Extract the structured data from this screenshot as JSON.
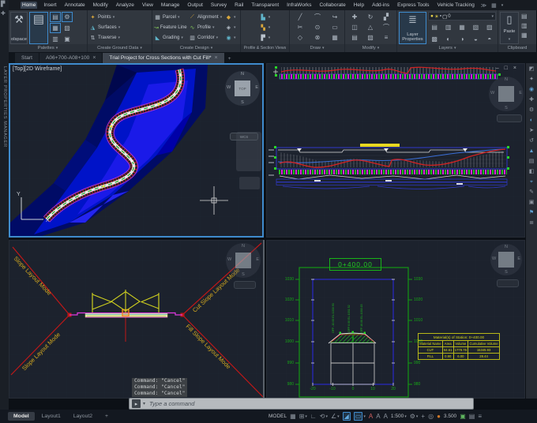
{
  "menubar": {
    "tabs": [
      "Home",
      "Insert",
      "Annotate",
      "Modify",
      "Analyze",
      "View",
      "Manage",
      "Output",
      "Survey",
      "Rail",
      "Transparent",
      "InfraWorks",
      "Collaborate",
      "Help",
      "Add-ins",
      "Express Tools",
      "Vehicle Tracking"
    ],
    "active_tab": "Home"
  },
  "glyphs": {
    "caret": "▾",
    "close": "×",
    "plus": "+",
    "minimize": "–",
    "restore": "□",
    "tools": "⚒",
    "toolspace_big": "▤",
    "points": "✦",
    "surfaces": "◮",
    "traverse": "⇅",
    "parcel": "▦",
    "feature_line": "↝",
    "grading": "◣",
    "alignment": "⟋",
    "profile": "∿",
    "corridor": "▥",
    "design_x1": "◆",
    "design_x2": "◈",
    "design_x3": "◉",
    "psv1": "▙",
    "psv2": "▚",
    "psv3": "▛",
    "d1": "╱",
    "d2": "⌒",
    "d3": "↪",
    "d4": "✂",
    "d5": "⊙",
    "d6": "▭",
    "d7": "◇",
    "d8": "⊗",
    "d9": "▦",
    "m1": "✚",
    "m2": "↻",
    "m3": "▞",
    "m4": "◫",
    "m5": "△",
    "m6": "⌒",
    "m7": "▤",
    "m8": "▧",
    "m9": "≡",
    "p1": "▤",
    "p2": "⚙",
    "p3": "▦",
    "p4": "▧",
    "p5": "▥",
    "p6": "▣",
    "bulb": "●",
    "sun": "☀",
    "lock": "▪",
    "swatch": "▢",
    "l1": "▤",
    "l2": "▥",
    "l3": "▦",
    "l4": "▧",
    "l5": "▨",
    "l6": "▩",
    "l7": "◐",
    "l8": "◑",
    "l9": "◒",
    "l10": "◓",
    "paste": "▯",
    "c1": "▤",
    "c2": "▥",
    "c3": "▦",
    "layer_props": "≣",
    "cmd": "▸",
    "app1": "▛",
    "app2": "✚",
    "ic1": "≫",
    "ic2": "▦",
    "ucs_x": "X",
    "ucs_y": "Y"
  },
  "ribbon": {
    "palettes": {
      "label": "Palettes",
      "toolspace_label": "olspace"
    },
    "create_ground_data": {
      "label": "Create Ground Data",
      "items": [
        "Points",
        "Surfaces",
        "Traverse"
      ]
    },
    "create_design": {
      "label": "Create Design",
      "col1": [
        "Parcel",
        "Feature Line",
        "Grading"
      ],
      "col2": [
        "Alignment",
        "Profile",
        "Corridor"
      ]
    },
    "profile_section_views": {
      "label": "Profile & Section Views"
    },
    "draw": {
      "label": "Draw"
    },
    "modify": {
      "label": "Modify"
    },
    "layers": {
      "label": "Layers",
      "button_label": "Layer Properties",
      "current_layer": "0"
    },
    "clipboard": {
      "label": "Clipboard",
      "paste_label": "Paste"
    }
  },
  "file_tabs": {
    "items": [
      "Start",
      "A06+700-A08+100",
      "Trial Project for Cross Sections with Cut Fill*"
    ]
  },
  "palette_strip": {
    "title": "LAYER PROPERTIES MANAGER"
  },
  "viewcube": {
    "n": "N",
    "s": "S",
    "e": "E",
    "w": "W",
    "face": "TOP",
    "wcs": "WCS"
  },
  "viewports": {
    "top_left": {
      "label": "[Top][2D Wireframe]"
    },
    "bottom_left": {
      "slope_top_left": "Slope Layout Mode",
      "slope_top_right": "Cut Slope Layout Mode",
      "slope_bottom_left": "Slope Layout Mode",
      "slope_bottom_right": "Fill Slope Layout Mode",
      "command_history": [
        "Command: \"Cancel\"",
        "Command: \"Cancel\"",
        "Command: \"Cancel\""
      ]
    },
    "bottom_right": {
      "station_label": "0+400.00",
      "elevations": [
        "1030",
        "1020",
        "1010",
        "1000",
        "990",
        "980"
      ],
      "offsets": [
        "-20",
        "-10",
        "0",
        "10",
        "20"
      ],
      "point_labels": [
        "OFF:-10.00 EL:1030.93",
        "OFF:0.00 EL:1031.52",
        "OFF:10.00 EL:1030.15"
      ],
      "material_table": {
        "title": "Material(s) of  Station: 0+400.00",
        "headers": [
          "Material Name",
          "Area",
          "Volume",
          "Cumulative Volume"
        ],
        "rows": [
          [
            "CUT",
            "64.61",
            "1779.76",
            "15345.93"
          ],
          [
            "FILL",
            "0.90",
            "6.00",
            "28.44"
          ]
        ]
      }
    }
  },
  "command_line": {
    "placeholder": "Type a command"
  },
  "status_bar": {
    "model_tabs": [
      "Model",
      "Layout1",
      "Layout2"
    ],
    "model_label": "MODEL",
    "scale": "1:500",
    "lod": "3.500",
    "icons": {
      "grid": "▦",
      "snap": "⊞",
      "ortho": "∟",
      "polar": "⟲",
      "osnap": "∠",
      "iso": "◢",
      "dyn": "▭",
      "a1": "A",
      "a2": "A",
      "a3": "A",
      "gear": "⚙",
      "plus": "+",
      "isolate": "◎",
      "globe": "●",
      "cube": "▣",
      "display": "▤",
      "menu": "≡"
    }
  },
  "right_toolbar": {
    "icons": [
      "◩",
      "✦",
      "◉",
      "✚",
      "⚙",
      "◐",
      "➤",
      "↺",
      "▲",
      "▤",
      "◧",
      "⌖",
      "✎",
      "▣",
      "⚑",
      "≣"
    ]
  }
}
